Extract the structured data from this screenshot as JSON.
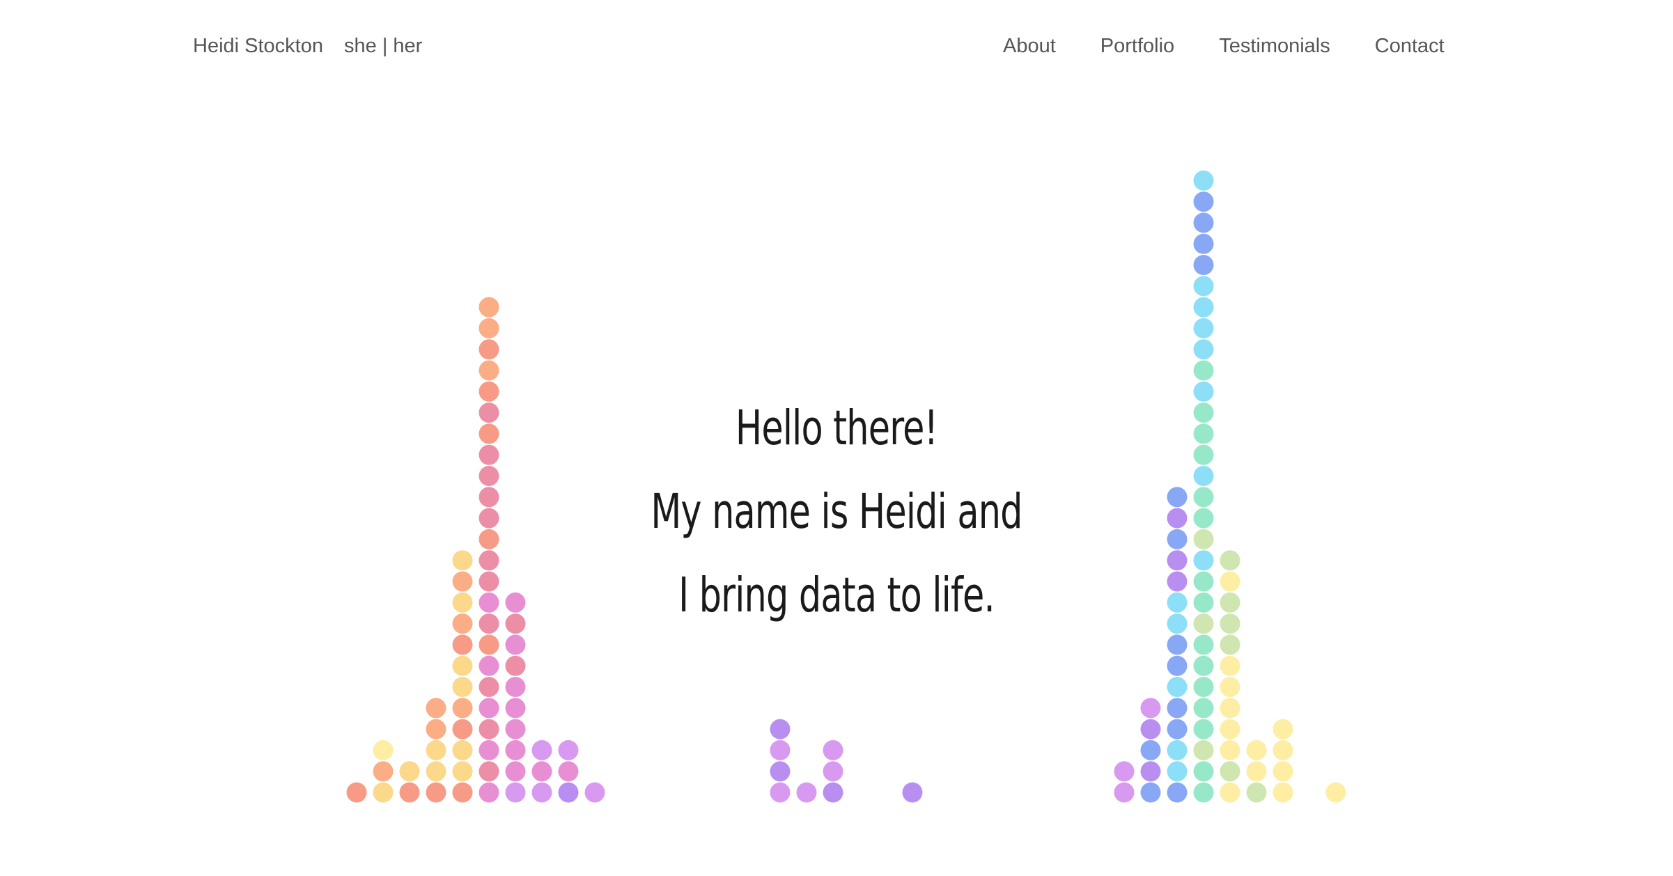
{
  "header": {
    "name": "Heidi Stockton",
    "pronouns": "she | her",
    "nav": [
      {
        "label": "About"
      },
      {
        "label": "Portfolio"
      },
      {
        "label": "Testimonials"
      },
      {
        "label": "Contact"
      }
    ]
  },
  "hero": {
    "line1": "Hello there!",
    "line2": "My name is Heidi and",
    "line3": "I bring data to life."
  },
  "dot_palette": {
    "peach": "#fbad86",
    "salmon": "#f79a86",
    "rose": "#ec8fa6",
    "yellow": "#fcd88b",
    "lightyellow": "#fdeea4",
    "pink": "#e88fd4",
    "violet": "#d89af0",
    "purple": "#b88ff0",
    "blue": "#88a8f6",
    "cyan": "#8cdff7",
    "mint": "#96e8c8",
    "sage": "#cfe6b0"
  },
  "dot_columns": [
    {
      "col": 0,
      "colors": [
        "salmon"
      ]
    },
    {
      "col": 1,
      "colors": [
        "yellow",
        "peach",
        "lightyellow"
      ]
    },
    {
      "col": 2,
      "colors": [
        "salmon",
        "yellow"
      ]
    },
    {
      "col": 3,
      "colors": [
        "salmon",
        "yellow",
        "yellow",
        "peach",
        "peach"
      ]
    },
    {
      "col": 4,
      "colors": [
        "salmon",
        "yellow",
        "yellow",
        "salmon",
        "peach",
        "yellow",
        "yellow",
        "salmon",
        "peach",
        "yellow",
        "peach",
        "yellow"
      ]
    },
    {
      "col": 5,
      "colors": [
        "pink",
        "rose",
        "pink",
        "rose",
        "pink",
        "rose",
        "pink",
        "salmon",
        "rose",
        "pink",
        "rose",
        "rose",
        "salmon",
        "rose",
        "rose",
        "rose",
        "rose",
        "salmon",
        "rose",
        "salmon",
        "peach",
        "salmon",
        "peach",
        "peach"
      ]
    },
    {
      "col": 6,
      "colors": [
        "violet",
        "pink",
        "pink",
        "pink",
        "pink",
        "pink",
        "rose",
        "pink",
        "rose",
        "pink"
      ]
    },
    {
      "col": 7,
      "colors": [
        "violet",
        "pink",
        "violet"
      ]
    },
    {
      "col": 8,
      "colors": [
        "purple",
        "pink",
        "violet"
      ]
    },
    {
      "col": 9,
      "colors": [
        "violet"
      ]
    },
    {
      "col": 16,
      "colors": [
        "violet",
        "purple",
        "violet",
        "purple"
      ]
    },
    {
      "col": 17,
      "colors": [
        "violet"
      ]
    },
    {
      "col": 18,
      "colors": [
        "purple",
        "violet",
        "violet"
      ]
    },
    {
      "col": 21,
      "colors": [
        "purple"
      ]
    },
    {
      "col": 29,
      "colors": [
        "violet",
        "violet"
      ]
    },
    {
      "col": 30,
      "colors": [
        "blue",
        "purple",
        "blue",
        "purple",
        "violet"
      ]
    },
    {
      "col": 31,
      "colors": [
        "blue",
        "cyan",
        "cyan",
        "blue",
        "blue",
        "cyan",
        "blue",
        "blue",
        "cyan",
        "cyan",
        "purple",
        "purple",
        "blue",
        "purple",
        "blue"
      ]
    },
    {
      "col": 32,
      "colors": [
        "mint",
        "mint",
        "sage",
        "mint",
        "mint",
        "mint",
        "mint",
        "mint",
        "sage",
        "mint",
        "mint",
        "cyan",
        "sage",
        "mint",
        "mint",
        "cyan",
        "mint",
        "mint",
        "mint",
        "cyan",
        "mint",
        "cyan",
        "cyan",
        "cyan",
        "cyan",
        "blue",
        "blue",
        "blue",
        "blue",
        "cyan"
      ]
    },
    {
      "col": 33,
      "colors": [
        "lightyellow",
        "sage",
        "lightyellow",
        "lightyellow",
        "lightyellow",
        "lightyellow",
        "lightyellow",
        "sage",
        "sage",
        "sage",
        "lightyellow",
        "sage"
      ]
    },
    {
      "col": 34,
      "colors": [
        "sage",
        "lightyellow",
        "lightyellow"
      ]
    },
    {
      "col": 35,
      "colors": [
        "lightyellow",
        "lightyellow",
        "lightyellow",
        "lightyellow"
      ]
    },
    {
      "col": 37,
      "colors": [
        "lightyellow"
      ]
    }
  ]
}
